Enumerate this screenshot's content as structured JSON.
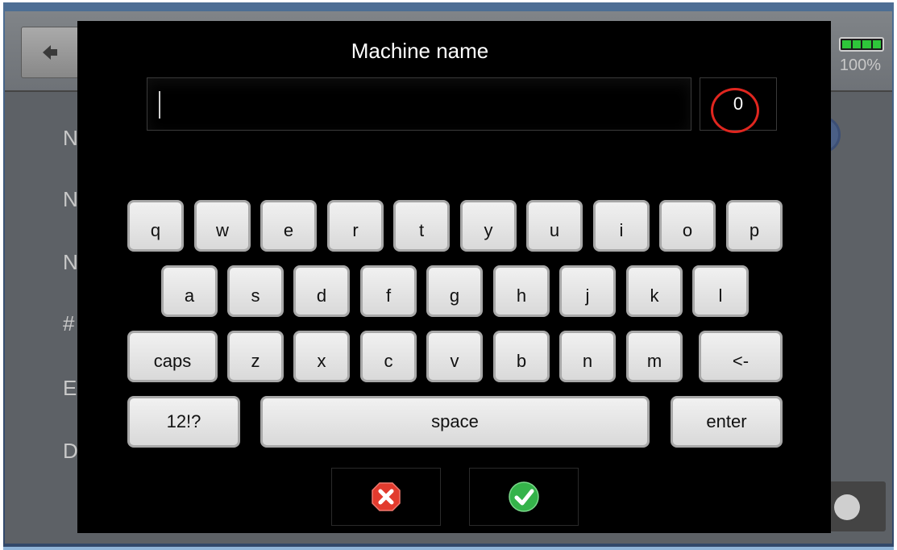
{
  "app": {
    "battery_percent": "100%",
    "background_labels": [
      "N",
      "N",
      "N",
      "#",
      "E",
      "D"
    ]
  },
  "dialog": {
    "title": "Machine name",
    "input_value": "",
    "character_count": "0"
  },
  "keyboard": {
    "row1": [
      "q",
      "w",
      "e",
      "r",
      "t",
      "y",
      "u",
      "i",
      "o",
      "p"
    ],
    "row2": [
      "a",
      "s",
      "d",
      "f",
      "g",
      "h",
      "j",
      "k",
      "l"
    ],
    "row3_left": "caps",
    "row3_letters": [
      "z",
      "x",
      "c",
      "v",
      "b",
      "n",
      "m"
    ],
    "row3_right": "<-",
    "row4_left": "12!?",
    "row4_space": "space",
    "row4_right": "enter"
  },
  "actions": {
    "cancel_icon": "cancel-icon",
    "confirm_icon": "confirm-check-icon",
    "cancel_color": "#e23b2e",
    "confirm_color": "#35b34a"
  }
}
